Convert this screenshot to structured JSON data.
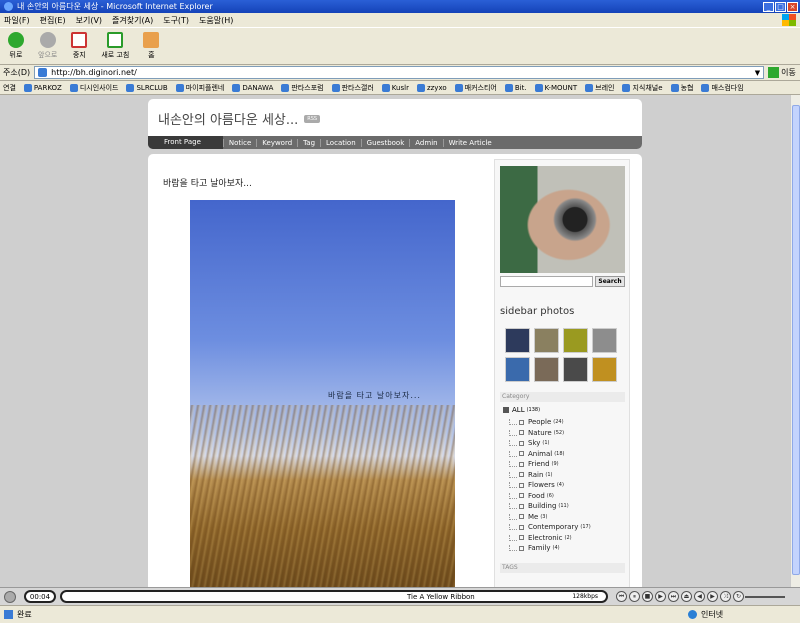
{
  "window": {
    "title": "내 손안의 아름다운 세상 - Microsoft Internet Explorer"
  },
  "menu": [
    "파일(F)",
    "편집(E)",
    "보기(V)",
    "즐겨찾기(A)",
    "도구(T)",
    "도움말(H)"
  ],
  "toolbar": {
    "back": "뒤로",
    "forward": "앞으로",
    "stop": "중지",
    "refresh": "새로 고침",
    "home": "홈"
  },
  "address": {
    "label": "주소(D)",
    "url": "http://bh.diginori.net/",
    "go": "이동"
  },
  "links": [
    "연결",
    "PARKOZ",
    "디시인사이드",
    "SLRCLUB",
    "마이피플렌네",
    "DANAWA",
    "판타스포럼",
    "판타스갤러",
    "Kuslr",
    "zzyxo",
    "매커스티어",
    "Bit.",
    "K-MOUNT",
    "브레인",
    "지식채널e",
    "농협",
    "매스컴다임"
  ],
  "blog": {
    "title": "내손안의 아름다운 세상...",
    "title_tag": "RSS",
    "nav_active": "Front Page",
    "nav": [
      "Notice",
      "Keyword",
      "Tag",
      "Location",
      "Guestbook",
      "Admin",
      "Write Article"
    ]
  },
  "post": {
    "title": "바람을 타고 날아보자...",
    "caption": "바람을 타고 날아보자..."
  },
  "sidebar": {
    "search_button": "Search",
    "photos_title": "sidebar photos",
    "thumb_colors": [
      "#2d3a5c",
      "#8a8060",
      "#9a9a20",
      "#8d8d8d",
      "#3a6aac",
      "#7a6a58",
      "#4a4a4a",
      "#c09020"
    ],
    "category_header": "Category",
    "all": {
      "label": "ALL",
      "count": "(138)"
    },
    "categories": [
      {
        "label": "People",
        "count": "(24)"
      },
      {
        "label": "Nature",
        "count": "(52)"
      },
      {
        "label": "Sky",
        "count": "(1)"
      },
      {
        "label": "Animal",
        "count": "(18)"
      },
      {
        "label": "Friend",
        "count": "(9)"
      },
      {
        "label": "Rain",
        "count": "(1)"
      },
      {
        "label": "Flowers",
        "count": "(4)"
      },
      {
        "label": "Food",
        "count": "(6)"
      },
      {
        "label": "Building",
        "count": "(11)"
      },
      {
        "label": "Me",
        "count": "(3)"
      },
      {
        "label": "Contemporary",
        "count": "(17)"
      },
      {
        "label": "Electronic",
        "count": "(2)"
      },
      {
        "label": "Family",
        "count": "(4)"
      }
    ],
    "tags_header": "TAGS"
  },
  "player": {
    "time": "00:04",
    "song": "Tie A Yellow Ribbon",
    "bitrate": "128kbps"
  },
  "status": {
    "text": "완료",
    "zone": "인터넷"
  }
}
